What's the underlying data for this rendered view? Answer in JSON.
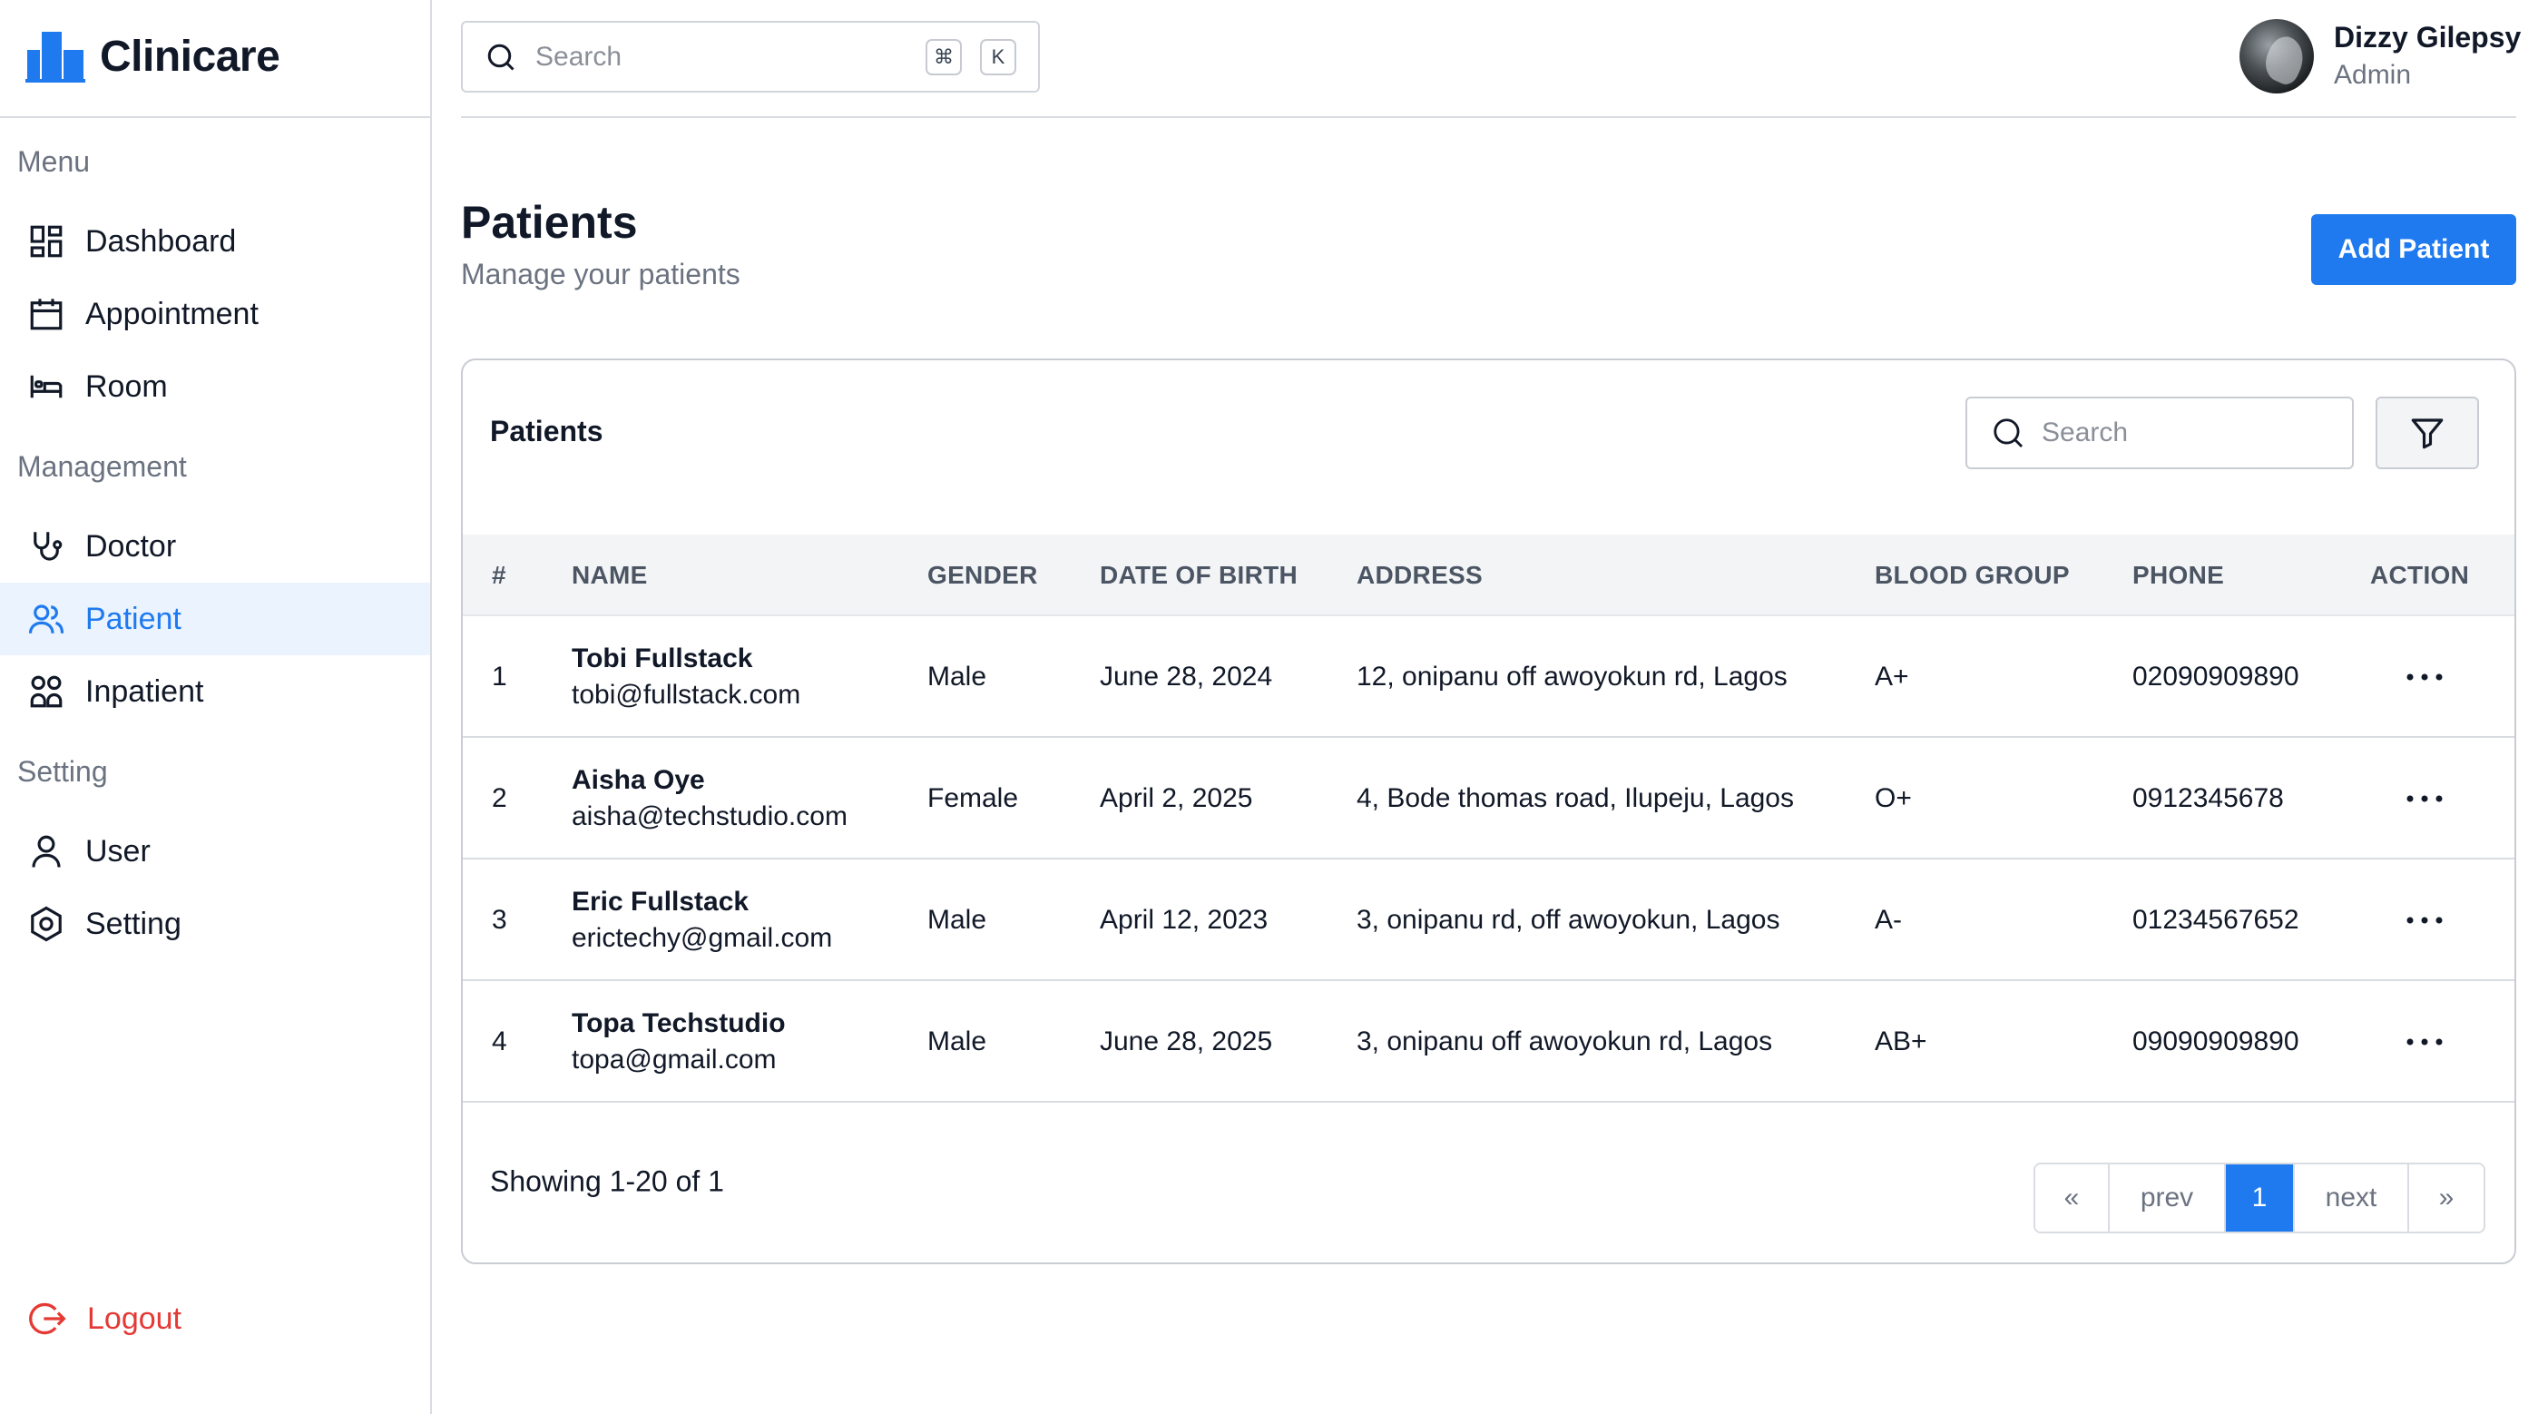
{
  "app": {
    "name": "Clinicare",
    "brand_color": "#1f7af0"
  },
  "sidebar": {
    "sections": [
      {
        "label": "Menu",
        "items": [
          {
            "label": "Dashboard",
            "icon": "dashboard-icon"
          },
          {
            "label": "Appointment",
            "icon": "calendar-icon"
          },
          {
            "label": "Room",
            "icon": "bed-icon"
          }
        ]
      },
      {
        "label": "Management",
        "items": [
          {
            "label": "Doctor",
            "icon": "stethoscope-icon"
          },
          {
            "label": "Patient",
            "icon": "users-icon",
            "active": true
          },
          {
            "label": "Inpatient",
            "icon": "grid-people-icon"
          }
        ]
      },
      {
        "label": "Setting",
        "items": [
          {
            "label": "User",
            "icon": "user-icon"
          },
          {
            "label": "Setting",
            "icon": "settings-hex-icon"
          }
        ]
      }
    ],
    "logout_label": "Logout"
  },
  "topbar": {
    "search_placeholder": "Search",
    "shortcut_keys": [
      "⌘",
      "K"
    ],
    "user": {
      "name": "Dizzy Gilepsy",
      "role": "Admin"
    }
  },
  "page": {
    "title": "Patients",
    "subtitle": "Manage your patients",
    "add_button": "Add Patient"
  },
  "table": {
    "title": "Patients",
    "search_placeholder": "Search",
    "columns": [
      "#",
      "NAME",
      "GENDER",
      "DATE OF BIRTH",
      "ADDRESS",
      "BLOOD GROUP",
      "PHONE",
      "ACTION"
    ],
    "rows": [
      {
        "index": "1",
        "name": "Tobi Fullstack",
        "email": "tobi@fullstack.com",
        "gender": "Male",
        "dob": "June 28, 2024",
        "address": "12, onipanu off awoyokun rd, Lagos",
        "blood_group": "A+",
        "phone": "02090909890"
      },
      {
        "index": "2",
        "name": "Aisha Oye",
        "email": "aisha@techstudio.com",
        "gender": "Female",
        "dob": "April 2, 2025",
        "address": "4, Bode thomas road, Ilupeju, Lagos",
        "blood_group": "O+",
        "phone": "0912345678"
      },
      {
        "index": "3",
        "name": "Eric Fullstack",
        "email": "erictechy@gmail.com",
        "gender": "Male",
        "dob": "April 12, 2023",
        "address": "3, onipanu rd, off awoyokun, Lagos",
        "blood_group": "A-",
        "phone": "01234567652"
      },
      {
        "index": "4",
        "name": "Topa Techstudio",
        "email": "topa@gmail.com",
        "gender": "Male",
        "dob": "June 28, 2025",
        "address": "3, onipanu off awoyokun rd, Lagos",
        "blood_group": "AB+",
        "phone": "09090909890"
      }
    ],
    "showing_text": "Showing 1-20 of 1",
    "pagination": {
      "first": "«",
      "prev": "prev",
      "current": "1",
      "next": "next",
      "last": "»"
    }
  }
}
